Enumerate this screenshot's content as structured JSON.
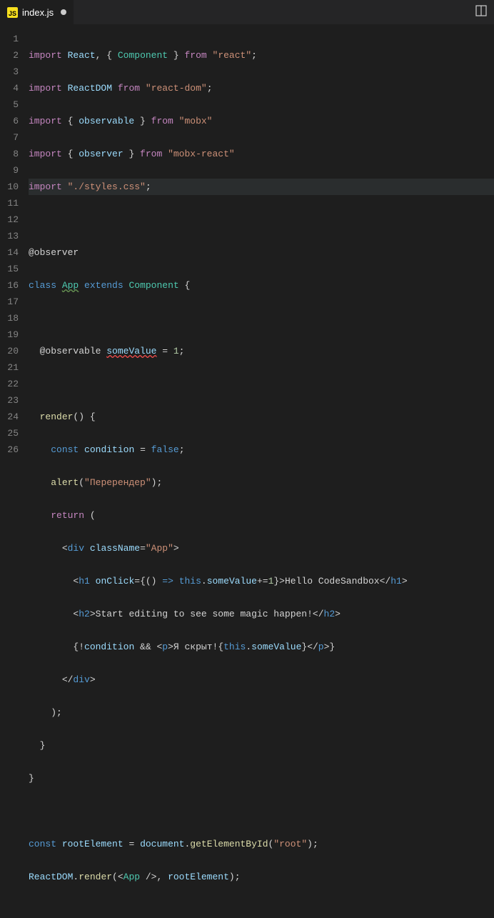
{
  "tab": {
    "icon": "JS",
    "label": "index.js"
  },
  "lines": [
    "1",
    "2",
    "3",
    "4",
    "5",
    "6",
    "7",
    "8",
    "9",
    "10",
    "11",
    "12",
    "13",
    "14",
    "15",
    "16",
    "17",
    "18",
    "19",
    "20",
    "21",
    "22",
    "23",
    "24",
    "25",
    "26"
  ],
  "code": {
    "l1": {
      "import": "import",
      "React": "React",
      "comma": ", { ",
      "Component": "Component",
      "close": " } ",
      "from": "from",
      "str": "\"react\"",
      "semi": ";"
    },
    "l2": {
      "import": "import",
      "ReactDOM": "ReactDOM",
      "from": "from",
      "str": "\"react-dom\"",
      "semi": ";"
    },
    "l3": {
      "import": "import",
      "open": " { ",
      "observable": "observable",
      "close": " } ",
      "from": "from",
      "str": "\"mobx\""
    },
    "l4": {
      "import": "import",
      "open": " { ",
      "observer": "observer",
      "close": " } ",
      "from": "from",
      "str": "\"mobx-react\""
    },
    "l5": {
      "import": "import",
      "str": "\"./styles.css\"",
      "semi": ";"
    },
    "l7": {
      "decor": "@observer"
    },
    "l8": {
      "class": "class",
      "App": "App",
      "extends": "extends",
      "Component": "Component",
      "brace": " {"
    },
    "l10": {
      "decor": "@observable ",
      "name": "someValue",
      "eq": " = ",
      "num": "1",
      "semi": ";"
    },
    "l12": {
      "render": "render",
      "paren": "() {"
    },
    "l13": {
      "const": "const",
      "condition": "condition",
      "eq": " = ",
      "false": "false",
      "semi": ";"
    },
    "l14": {
      "alert": "alert",
      "open": "(",
      "str": "\"Перерендер\"",
      "close": ");"
    },
    "l15": {
      "return": "return",
      "paren": " ("
    },
    "l16": {
      "open": "<",
      "tag": "div",
      "sp": " ",
      "attr": "className",
      "eq": "=",
      "str": "\"App\"",
      "close": ">"
    },
    "l17": {
      "open": "<",
      "tag": "h1",
      "sp": " ",
      "attr": "onClick",
      "eq": "={() ",
      "arrow": "=>",
      "sp2": " ",
      "this": "this",
      "dot": ".",
      "prop": "someValue",
      "inc": "+=",
      "num": "1",
      "close": "}>",
      "text": "Hello CodeSandbox",
      "ctag": "</",
      "ctagn": "h1",
      "cend": ">"
    },
    "l18": {
      "open": "<",
      "tag": "h2",
      "close": ">",
      "text": "Start editing to see some magic happen!",
      "ctag": "</",
      "ctagn": "h2",
      "cend": ">"
    },
    "l19": {
      "open": "{!",
      "cond": "condition",
      "and": " && ",
      "popen": "<",
      "ptag": "p",
      "pclose": ">",
      "text": "Я скрыт!{",
      "this": "this",
      "dot": ".",
      "prop": "someValue",
      "tclose": "}",
      "ctag": "</",
      "ctagn": "p",
      "cend": ">}"
    },
    "l20": {
      "open": "</",
      "tag": "div",
      "close": ">"
    },
    "l21": {
      "close": ");"
    },
    "l22": {
      "close": "}"
    },
    "l23": {
      "close": "}"
    },
    "l25": {
      "const": "const",
      "name": "rootElement",
      "eq": " = ",
      "doc": "document",
      "dot": ".",
      "fn": "getElementById",
      "open": "(",
      "str": "\"root\"",
      "close": ");"
    },
    "l26": {
      "ReactDOM": "ReactDOM",
      "dot": ".",
      "render": "render",
      "open": "(<",
      "App": "App",
      "sp": " />, ",
      "root": "rootElement",
      "close": ");"
    }
  }
}
